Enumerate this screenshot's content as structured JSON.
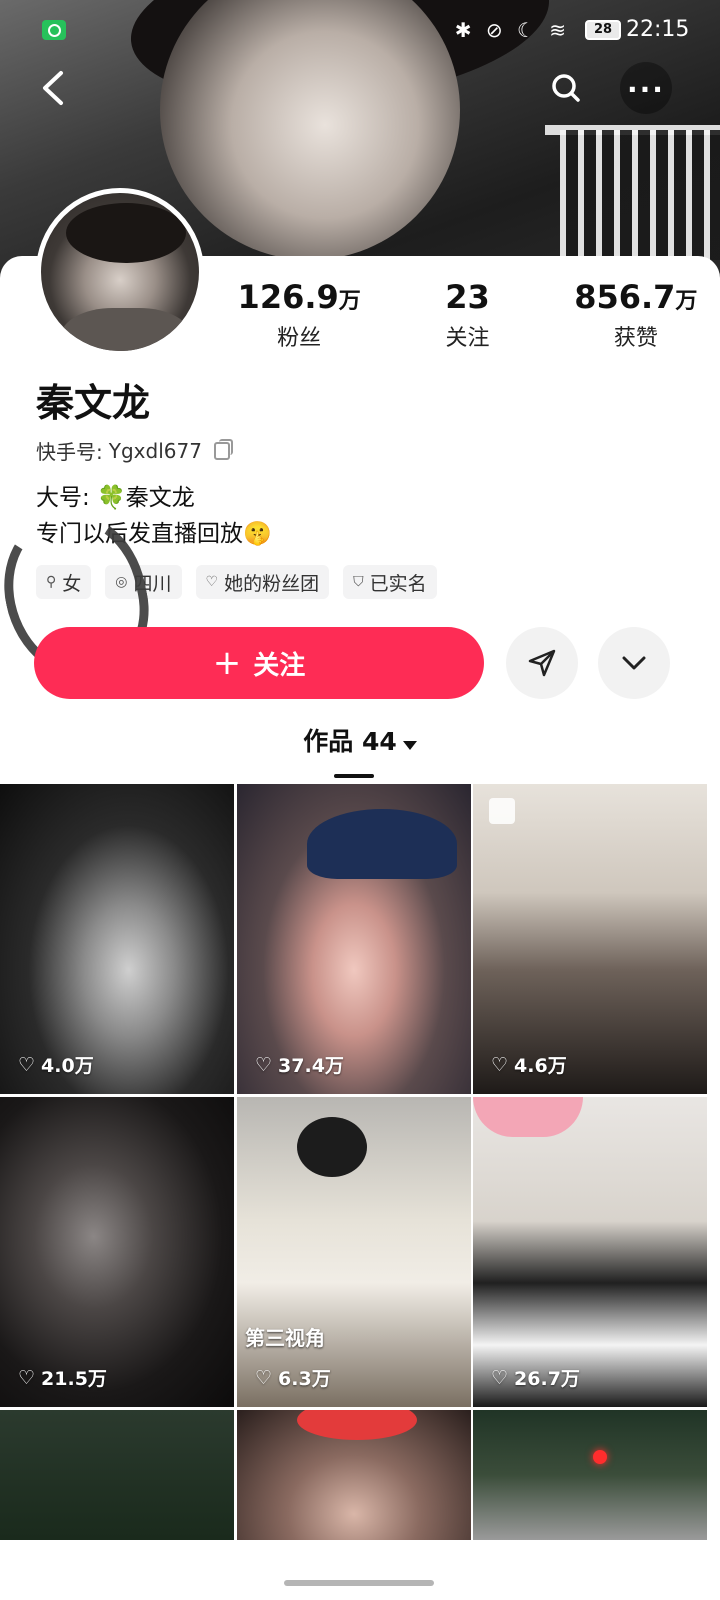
{
  "status_bar": {
    "battery": "28",
    "time": "22:15",
    "icons": "✱ ⊘ ☾ ≋"
  },
  "profile": {
    "stats": [
      {
        "value": "126.9",
        "unit": "万",
        "label": "粉丝"
      },
      {
        "value": "23",
        "unit": "",
        "label": "关注"
      },
      {
        "value": "856.7",
        "unit": "万",
        "label": "获赞"
      }
    ],
    "name": "秦文龙",
    "kuaishou_id_label": "快手号:",
    "kuaishou_id": "Ygxdl677",
    "bio_line1_prefix": "大号:",
    "bio_line1_clover": "🍀",
    "bio_line1_name": "秦文龙",
    "bio_line2": "专门以后发直播回放🤫",
    "tags": [
      {
        "icon": "female-icon",
        "glyph": "⚲",
        "label": "女"
      },
      {
        "icon": "location-icon",
        "glyph": "◎",
        "label": "四川"
      },
      {
        "icon": "fan-club-icon",
        "glyph": "♡",
        "label": "她的粉丝团"
      },
      {
        "icon": "verified-icon",
        "glyph": "⛉",
        "label": "已实名"
      }
    ]
  },
  "actions": {
    "follow_label": "关注",
    "follow_plus": "+"
  },
  "tabs": {
    "works_label": "作品 44"
  },
  "grid": [
    {
      "likes": "4.0万",
      "caption": ""
    },
    {
      "likes": "37.4万",
      "caption": ""
    },
    {
      "likes": "4.6万",
      "caption": ""
    },
    {
      "likes": "21.5万",
      "caption": ""
    },
    {
      "likes": "6.3万",
      "caption": "第三视角"
    },
    {
      "likes": "26.7万",
      "caption": ""
    },
    {
      "likes": "",
      "caption": ""
    },
    {
      "likes": "",
      "caption": ""
    },
    {
      "likes": "",
      "caption": ""
    }
  ],
  "colors": {
    "accent": "#fe2c55"
  }
}
